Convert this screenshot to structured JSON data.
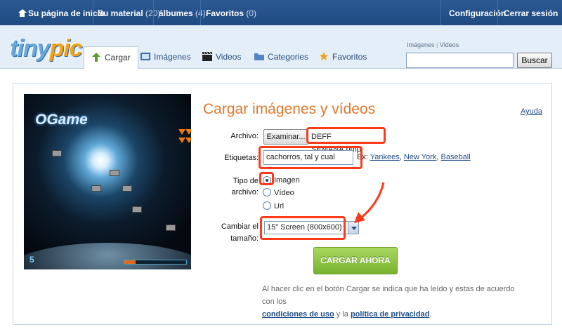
{
  "topbar": {
    "home": "Su página de inicio",
    "material": "Su material",
    "material_count": "(20)",
    "albums": "álbumes",
    "albums_count": "(4)",
    "favorites": "Favoritos",
    "favorites_count": "(0)",
    "settings": "Configuración",
    "logout": "Cerrar sesión"
  },
  "logo": {
    "part1": "tiny",
    "part2": "pic"
  },
  "tabs": [
    {
      "label": "Cargar",
      "icon": "upload-arrow-icon",
      "active": true
    },
    {
      "label": "Imágenes",
      "icon": "images-icon"
    },
    {
      "label": "Videos",
      "icon": "clapperboard-icon"
    },
    {
      "label": "Categories",
      "icon": "folder-icon"
    },
    {
      "label": "Favoritos",
      "icon": "star-icon"
    }
  ],
  "search": {
    "link_images": "Imágenes",
    "separator": "|",
    "link_videos": "Videos",
    "value": "",
    "button": "Buscar"
  },
  "preview": {
    "game_logo": "OGame",
    "level_number": "5",
    "progress_fraction": 0.18
  },
  "form": {
    "title": "Cargar imágenes y vídeos",
    "help": "Ayuda",
    "file_label": "Archivo:",
    "browse_button": "Examinar...",
    "file_name": "DEFF SEMANA.bmp",
    "tags_label": "Etiquetas:",
    "tags_value": "cachorros, tal y cual",
    "example_prefix": "Ex:",
    "example_tags": [
      "Yankees",
      "New York",
      "Baseball"
    ],
    "type_label_1": "Tipo de",
    "type_label_2": "archivo:",
    "type_options": [
      "Imagen",
      "Vídeo",
      "Url"
    ],
    "type_selected": "Imagen",
    "resize_label_1": "Cambiar el",
    "resize_label_2": "tamaño:",
    "resize_value": "15\" Screen (800x600)",
    "upload_button": "CARGAR AHORA",
    "legal_text": "Al hacer clic en el botón Cargar se indica que ha leído y estas de acuerdo con los",
    "terms_link": "condiciones de uso",
    "legal_and": "y la",
    "privacy_link": "política de privacidad",
    "legal_end": "."
  },
  "colors": {
    "topbar": "#24528c",
    "header_bg": "#e4eef8",
    "title": "#e0772b",
    "upload_button": "#8cc63f",
    "annotation": "#ff3a1a"
  }
}
